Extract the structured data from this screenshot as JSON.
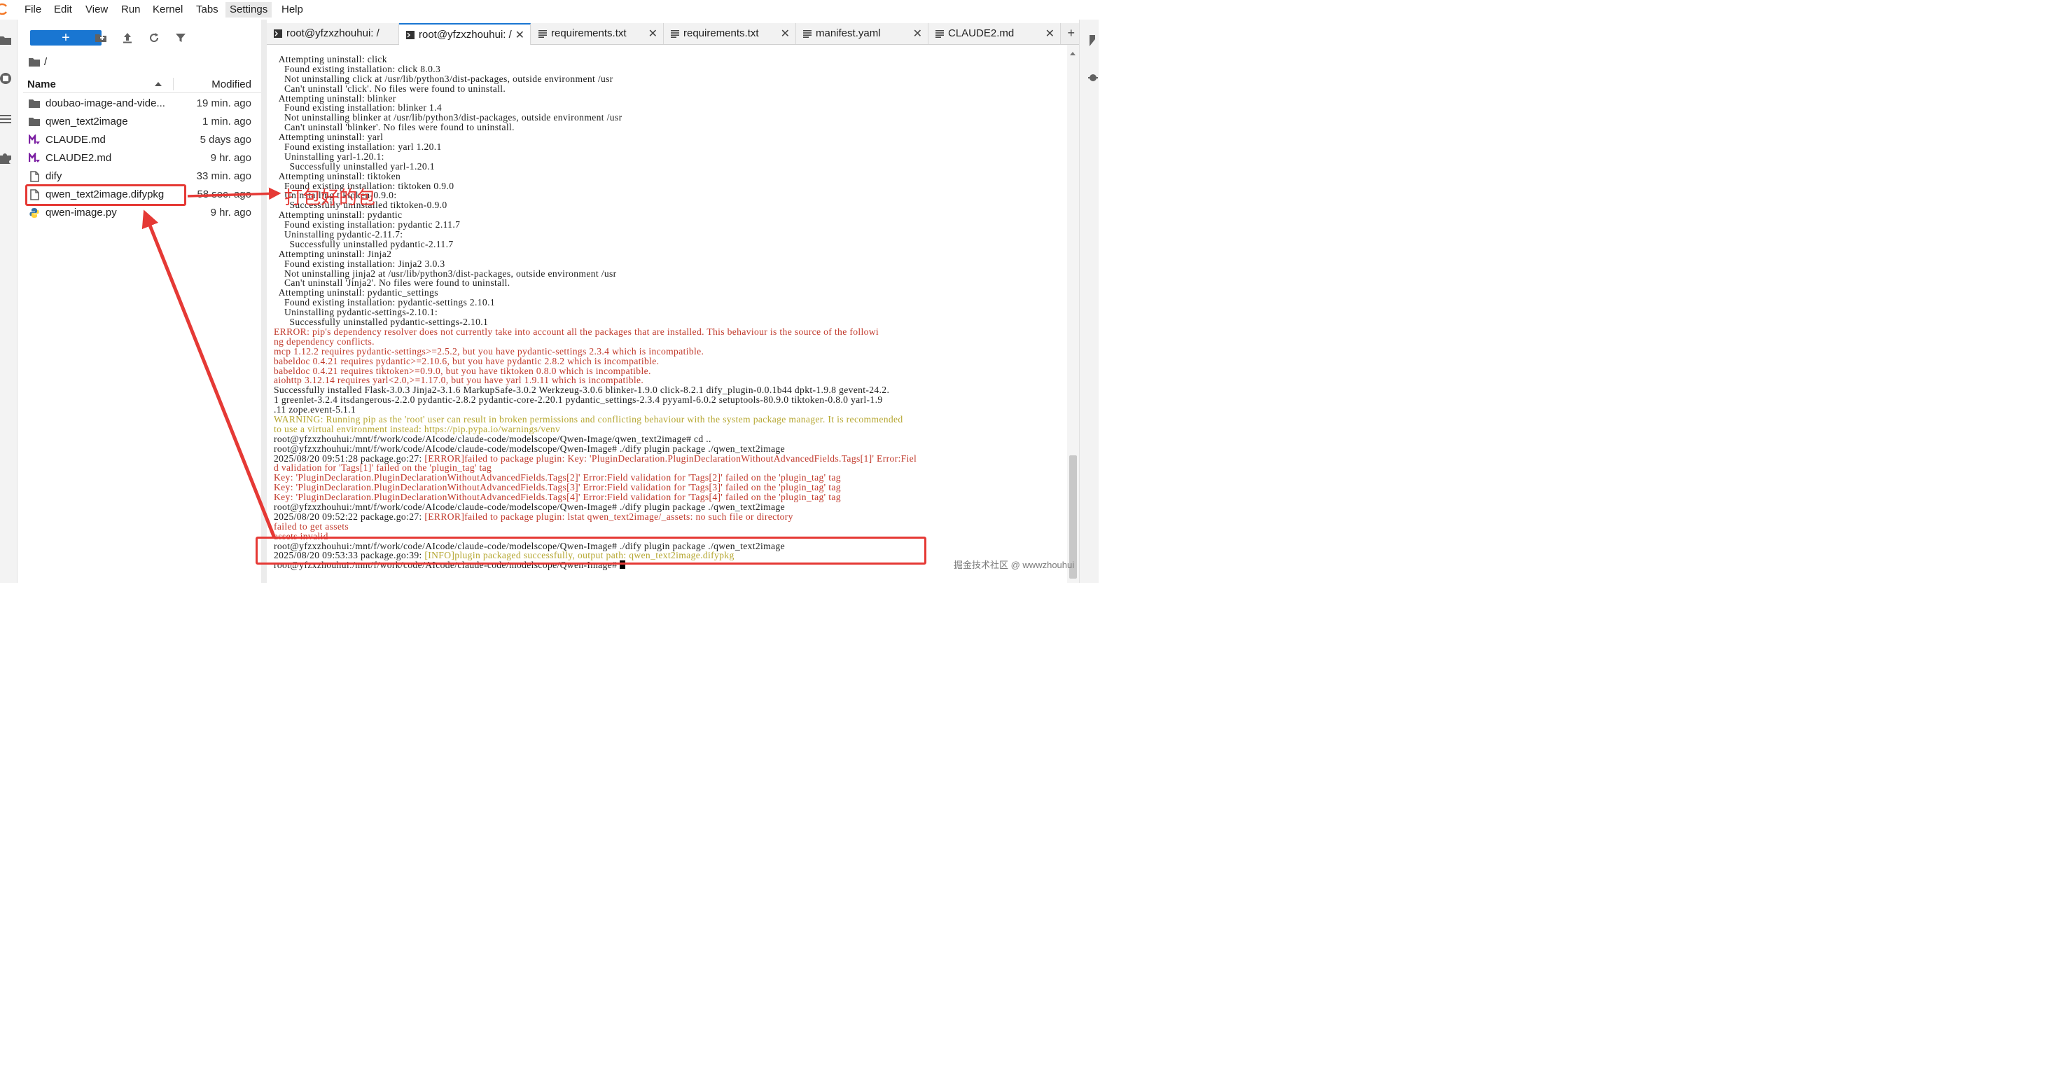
{
  "menu": {
    "items": [
      "File",
      "Edit",
      "View",
      "Run",
      "Kernel",
      "Tabs",
      "Settings",
      "Help"
    ],
    "active": "Settings"
  },
  "filebrowser": {
    "new_label": "+",
    "breadcrumb": "/",
    "header": {
      "name": "Name",
      "modified": "Modified"
    },
    "files": [
      {
        "name": "doubao-image-and-vide...",
        "modified": "19 min. ago",
        "icon": "folder-icon"
      },
      {
        "name": "qwen_text2image",
        "modified": "1 min. ago",
        "icon": "folder-icon"
      },
      {
        "name": "CLAUDE.md",
        "modified": "5 days ago",
        "icon": "markdown-icon"
      },
      {
        "name": "CLAUDE2.md",
        "modified": "9 hr. ago",
        "icon": "markdown-icon"
      },
      {
        "name": "dify",
        "modified": "33 min. ago",
        "icon": "file-icon"
      },
      {
        "name": "qwen_text2image.difypkg",
        "modified": "58 sec. ago",
        "icon": "file-icon"
      },
      {
        "name": "qwen-image.py",
        "modified": "9 hr. ago",
        "icon": "python-icon"
      }
    ]
  },
  "tabs": [
    {
      "label": "root@yfzxzhouhui: /",
      "icon": "terminal-icon",
      "active": false
    },
    {
      "label": "root@yfzxzhouhui: /",
      "icon": "terminal-icon",
      "active": true
    },
    {
      "label": "requirements.txt",
      "icon": "text-file-icon",
      "active": false
    },
    {
      "label": "requirements.txt",
      "icon": "text-file-icon",
      "active": false
    },
    {
      "label": "manifest.yaml",
      "icon": "text-file-icon",
      "active": false
    },
    {
      "label": "CLAUDE2.md",
      "icon": "text-file-icon",
      "active": false
    }
  ],
  "terminal": {
    "lines": [
      {
        "t": "  Attempting uninstall: click",
        "c": "norm"
      },
      {
        "t": "    Found existing installation: click 8.0.3",
        "c": "norm"
      },
      {
        "t": "    Not uninstalling click at /usr/lib/python3/dist-packages, outside environment /usr",
        "c": "norm"
      },
      {
        "t": "    Can't uninstall 'click'. No files were found to uninstall.",
        "c": "norm"
      },
      {
        "t": "  Attempting uninstall: blinker",
        "c": "norm"
      },
      {
        "t": "    Found existing installation: blinker 1.4",
        "c": "norm"
      },
      {
        "t": "    Not uninstalling blinker at /usr/lib/python3/dist-packages, outside environment /usr",
        "c": "norm"
      },
      {
        "t": "    Can't uninstall 'blinker'. No files were found to uninstall.",
        "c": "norm"
      },
      {
        "t": "  Attempting uninstall: yarl",
        "c": "norm"
      },
      {
        "t": "    Found existing installation: yarl 1.20.1",
        "c": "norm"
      },
      {
        "t": "    Uninstalling yarl-1.20.1:",
        "c": "norm"
      },
      {
        "t": "      Successfully uninstalled yarl-1.20.1",
        "c": "norm"
      },
      {
        "t": "  Attempting uninstall: tiktoken",
        "c": "norm"
      },
      {
        "t": "    Found existing installation: tiktoken 0.9.0",
        "c": "norm"
      },
      {
        "t": "    Uninstalling tiktoken-0.9.0:",
        "c": "norm"
      },
      {
        "t": "      Successfully uninstalled tiktoken-0.9.0",
        "c": "norm"
      },
      {
        "t": "  Attempting uninstall: pydantic",
        "c": "norm"
      },
      {
        "t": "    Found existing installation: pydantic 2.11.7",
        "c": "norm"
      },
      {
        "t": "    Uninstalling pydantic-2.11.7:",
        "c": "norm"
      },
      {
        "t": "      Successfully uninstalled pydantic-2.11.7",
        "c": "norm"
      },
      {
        "t": "  Attempting uninstall: Jinja2",
        "c": "norm"
      },
      {
        "t": "    Found existing installation: Jinja2 3.0.3",
        "c": "norm"
      },
      {
        "t": "    Not uninstalling jinja2 at /usr/lib/python3/dist-packages, outside environment /usr",
        "c": "norm"
      },
      {
        "t": "    Can't uninstall 'Jinja2'. No files were found to uninstall.",
        "c": "norm"
      },
      {
        "t": "  Attempting uninstall: pydantic_settings",
        "c": "norm"
      },
      {
        "t": "    Found existing installation: pydantic-settings 2.10.1",
        "c": "norm"
      },
      {
        "t": "    Uninstalling pydantic-settings-2.10.1:",
        "c": "norm"
      },
      {
        "t": "      Successfully uninstalled pydantic-settings-2.10.1",
        "c": "norm"
      },
      {
        "t": "ERROR: pip's dependency resolver does not currently take into account all the packages that are installed. This behaviour is the source of the followi",
        "c": "red"
      },
      {
        "t": "ng dependency conflicts.",
        "c": "red"
      },
      {
        "t": "mcp 1.12.2 requires pydantic-settings>=2.5.2, but you have pydantic-settings 2.3.4 which is incompatible.",
        "c": "red"
      },
      {
        "t": "babeldoc 0.4.21 requires pydantic>=2.10.6, but you have pydantic 2.8.2 which is incompatible.",
        "c": "red"
      },
      {
        "t": "babeldoc 0.4.21 requires tiktoken>=0.9.0, but you have tiktoken 0.8.0 which is incompatible.",
        "c": "red"
      },
      {
        "t": "aiohttp 3.12.14 requires yarl<2.0,>=1.17.0, but you have yarl 1.9.11 which is incompatible.",
        "c": "red"
      },
      {
        "t": "Successfully installed Flask-3.0.3 Jinja2-3.1.6 MarkupSafe-3.0.2 Werkzeug-3.0.6 blinker-1.9.0 click-8.2.1 dify_plugin-0.0.1b44 dpkt-1.9.8 gevent-24.2.",
        "c": "norm"
      },
      {
        "t": "1 greenlet-3.2.4 itsdangerous-2.2.0 pydantic-2.8.2 pydantic-core-2.20.1 pydantic_settings-2.3.4 pyyaml-6.0.2 setuptools-80.9.0 tiktoken-0.8.0 yarl-1.9",
        "c": "norm"
      },
      {
        "t": ".11 zope.event-5.1.1",
        "c": "norm"
      },
      {
        "t": "WARNING: Running pip as the 'root' user can result in broken permissions and conflicting behaviour with the system package manager. It is recommended",
        "c": "yellow"
      },
      {
        "t": "to use a virtual environment instead: https://pip.pypa.io/warnings/venv",
        "c": "yellow"
      },
      {
        "t": "root@yfzxzhouhui:/mnt/f/work/code/AIcode/claude-code/modelscope/Qwen-Image/qwen_text2image# cd ..",
        "c": "norm"
      },
      {
        "t": "root@yfzxzhouhui:/mnt/f/work/code/AIcode/claude-code/modelscope/Qwen-Image# ./dify plugin package ./qwen_text2image",
        "c": "norm"
      },
      {
        "t": "2025/08/20 09:51:28 package.go:27: [ERROR]failed to package plugin: Key: 'PluginDeclaration.PluginDeclarationWithoutAdvancedFields.Tags[1]' Error:Fiel",
        "c": "mixed",
        "p": "2025/08/20 09:51:28 package.go:27: "
      },
      {
        "t": "d validation for 'Tags[1]' failed on the 'plugin_tag' tag",
        "c": "red"
      },
      {
        "t": "Key: 'PluginDeclaration.PluginDeclarationWithoutAdvancedFields.Tags[2]' Error:Field validation for 'Tags[2]' failed on the 'plugin_tag' tag",
        "c": "red"
      },
      {
        "t": "Key: 'PluginDeclaration.PluginDeclarationWithoutAdvancedFields.Tags[3]' Error:Field validation for 'Tags[3]' failed on the 'plugin_tag' tag",
        "c": "red"
      },
      {
        "t": "Key: 'PluginDeclaration.PluginDeclarationWithoutAdvancedFields.Tags[4]' Error:Field validation for 'Tags[4]' failed on the 'plugin_tag' tag",
        "c": "red"
      },
      {
        "t": "root@yfzxzhouhui:/mnt/f/work/code/AIcode/claude-code/modelscope/Qwen-Image# ./dify plugin package ./qwen_text2image",
        "c": "norm"
      },
      {
        "t": "2025/08/20 09:52:22 package.go:27: [ERROR]failed to package plugin: lstat qwen_text2image/_assets: no such file or directory",
        "c": "mixed",
        "p": "2025/08/20 09:52:22 package.go:27: "
      },
      {
        "t": "failed to get assets",
        "c": "red"
      },
      {
        "t": "assets invalid",
        "c": "red"
      },
      {
        "t": "root@yfzxzhouhui:/mnt/f/work/code/AIcode/claude-code/modelscope/Qwen-Image# ./dify plugin package ./qwen_text2image",
        "c": "norm"
      },
      {
        "t": "2025/08/20 09:53:33 package.go:39: [INFO]plugin packaged successfully, output path: qwen_text2image.difypkg",
        "c": "mixedy",
        "p": "2025/08/20 09:53:33 package.go:39: "
      },
      {
        "t": "root@yfzxzhouhui:/mnt/f/work/code/AIcode/claude-code/modelscope/Qwen-Image# ",
        "c": "prompt"
      }
    ]
  },
  "annotation": {
    "label": "打包好的包"
  },
  "watermark": "掘金技术社区 @ wwwzhouhui",
  "colors": {
    "accent": "#1976d2",
    "annotation_red": "#e53935",
    "term_red": "#c0392b",
    "term_yellow": "#b5a630"
  }
}
